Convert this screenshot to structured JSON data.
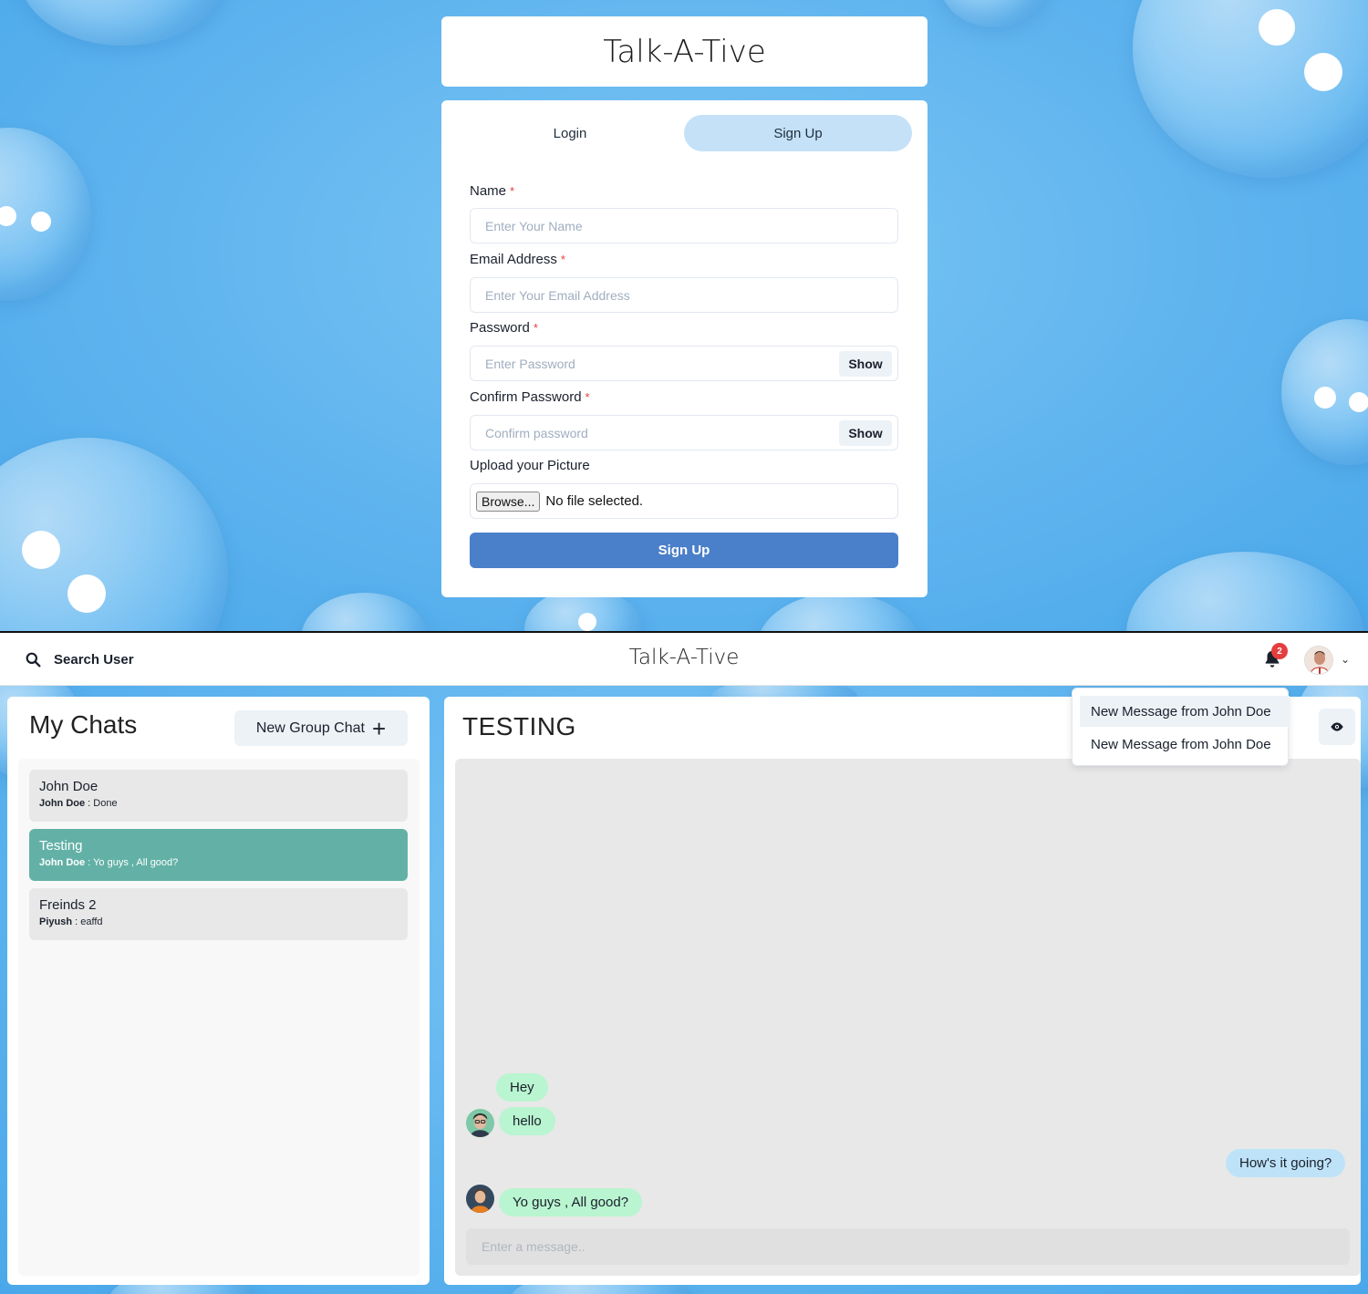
{
  "app": {
    "title": "Talk-A-Tive"
  },
  "auth": {
    "tabs": [
      {
        "label": "Login"
      },
      {
        "label": "Sign Up"
      }
    ],
    "fields": {
      "name": {
        "label": "Name",
        "required_mark": "*",
        "placeholder": "Enter Your Name"
      },
      "email": {
        "label": "Email Address",
        "required_mark": "*",
        "placeholder": "Enter Your Email Address"
      },
      "password": {
        "label": "Password",
        "required_mark": "*",
        "placeholder": "Enter Password",
        "toggle_label": "Show"
      },
      "confirm": {
        "label": "Confirm Password",
        "required_mark": "*",
        "placeholder": "Confirm password",
        "toggle_label": "Show"
      },
      "picture": {
        "label": "Upload your Picture",
        "browse_label": "Browse...",
        "status": "No file selected."
      }
    },
    "submit_label": "Sign Up",
    "colors": {
      "primary": "#4a7fc9",
      "active_tab": "#c5e1f8"
    }
  },
  "chat_app": {
    "header": {
      "search_label": "Search User",
      "title": "Talk-A-Tive",
      "notification_count": "2",
      "icons": [
        "search-icon",
        "bell-icon",
        "avatar",
        "chevron-down-icon"
      ]
    },
    "notifications": [
      {
        "text": "New Message from John Doe"
      },
      {
        "text": "New Message from John Doe"
      }
    ],
    "my_chats": {
      "title": "My Chats",
      "new_group_label": "New Group Chat",
      "new_group_icon": "+",
      "items": [
        {
          "name": "John Doe",
          "sender": "John Doe",
          "separator": " : ",
          "preview": "Done",
          "active": false
        },
        {
          "name": "Testing",
          "sender": "John Doe",
          "separator": " : ",
          "preview": "Yo guys , All good?",
          "active": true
        },
        {
          "name": "Freinds 2",
          "sender": "Piyush",
          "separator": " : ",
          "preview": "eaffd",
          "active": false
        }
      ]
    },
    "conversation": {
      "title": "TESTING",
      "messages": [
        {
          "text": "Hey",
          "side": "left"
        },
        {
          "text": "hello",
          "side": "left"
        },
        {
          "text": "How's it going?",
          "side": "right"
        },
        {
          "text": "Yo guys , All good?",
          "side": "left"
        }
      ],
      "input_placeholder": "Enter a message.."
    },
    "colors": {
      "active_chat": "#63b1a6",
      "incoming_bubble": "#b9f5d0",
      "outgoing_bubble": "#bee3f8",
      "badge": "#e53e3e"
    }
  }
}
